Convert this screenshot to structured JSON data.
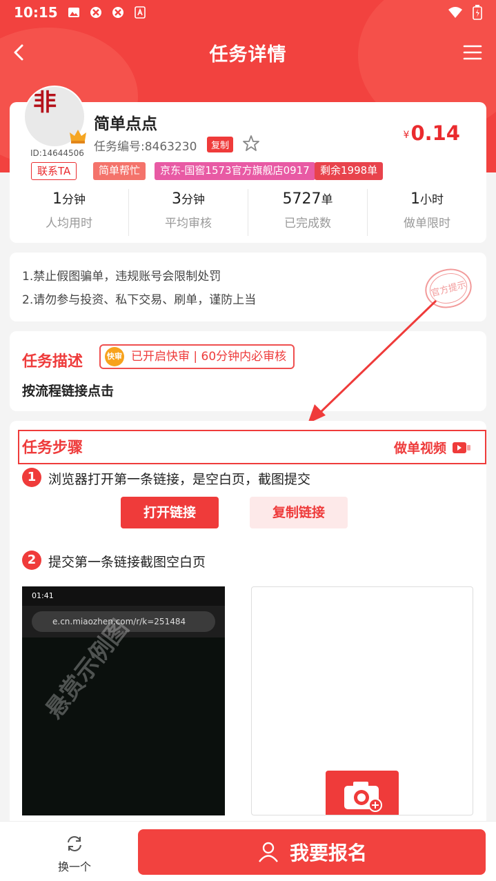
{
  "status_bar": {
    "time": "10:15"
  },
  "nav": {
    "title": "任务详情"
  },
  "task": {
    "avatar_text": "非",
    "user_id": "ID:14644506",
    "name": "简单点点",
    "number": "任务编号:8463230",
    "copy_label": "复制",
    "price_symbol": "¥",
    "price": "0.14",
    "tags": {
      "contact": "联系TA",
      "simple": "简单帮忙",
      "shop": "京东-国窖1573官方旗舰店0917",
      "remaining": "剩余1998单"
    },
    "stats": [
      {
        "value": "1",
        "unit": "分钟",
        "label": "人均用时"
      },
      {
        "value": "3",
        "unit": "分钟",
        "label": "平均审核"
      },
      {
        "value": "5727",
        "unit": "单",
        "label": "已完成数"
      },
      {
        "value": "1",
        "unit": "小时",
        "label": "做单限时"
      }
    ]
  },
  "notice": {
    "line1": "1.禁止假图骗单，违规账号会限制处罚",
    "line2": "2.请勿参与投资、私下交易、刷单，谨防上当",
    "stamp": "官方提示"
  },
  "description": {
    "title": "任务描述",
    "fast_icon": "快审",
    "fast_text": "已开启快审 | 60分钟内必审核",
    "text": "按流程链接点击"
  },
  "steps": {
    "title": "任务步骤",
    "video_label": "做单视频",
    "step1_num": "1",
    "step1_text": "浏览器打开第一条链接，是空白页，截图提交",
    "open_link": "打开链接",
    "copy_link": "复制链接",
    "step2_num": "2",
    "step2_text": "提交第一条链接截图空白页",
    "sample_time": "01:41",
    "sample_url": "e.cn.miaozhen.com/r/k=251484",
    "watermark": "悬赏示例图"
  },
  "bottom": {
    "switch_label": "换一个",
    "signup_label": "我要报名"
  },
  "colors": {
    "primary": "#f2423f",
    "accent": "#ee3b3b"
  }
}
